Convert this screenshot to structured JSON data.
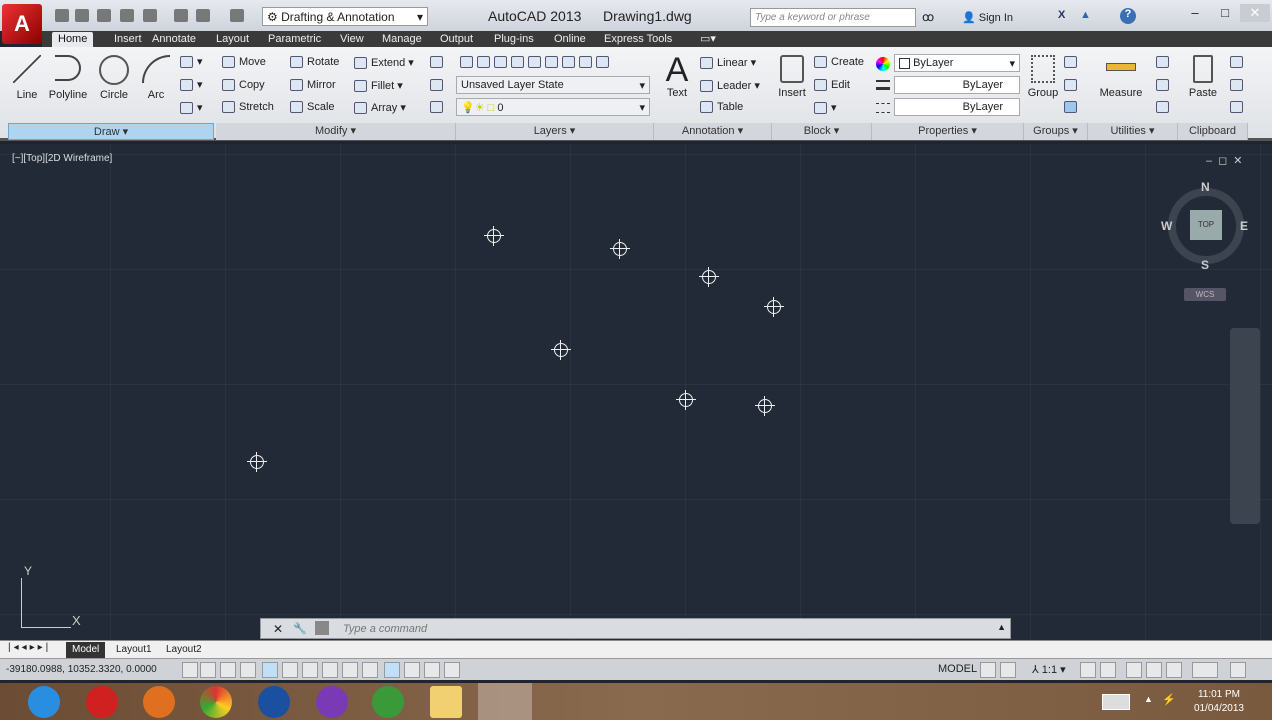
{
  "titlebar": {
    "app_title": "AutoCAD 2013",
    "file_title": "Drawing1.dwg",
    "workspace": "Drafting & Annotation",
    "search_placeholder": "Type a keyword or phrase",
    "sign_in": "Sign In",
    "logo": "A"
  },
  "tabs": [
    "Home",
    "Insert",
    "Annotate",
    "Layout",
    "Parametric",
    "View",
    "Manage",
    "Output",
    "Plug-ins",
    "Online",
    "Express Tools"
  ],
  "ribbon": {
    "draw": {
      "title": "Draw",
      "line": "Line",
      "polyline": "Polyline",
      "circle": "Circle",
      "arc": "Arc"
    },
    "modify": {
      "title": "Modify",
      "move": "Move",
      "rotate": "Rotate",
      "extend": "Extend",
      "copy": "Copy",
      "mirror": "Mirror",
      "fillet": "Fillet",
      "stretch": "Stretch",
      "scale": "Scale",
      "array": "Array"
    },
    "layers": {
      "title": "Layers",
      "layer_state": "Unsaved Layer State",
      "current_layer": "0"
    },
    "annotation": {
      "title": "Annotation",
      "text": "Text",
      "linear": "Linear",
      "leader": "Leader",
      "table": "Table"
    },
    "block": {
      "title": "Block",
      "insert": "Insert",
      "create": "Create",
      "edit": "Edit"
    },
    "properties": {
      "title": "Properties",
      "color": "ByLayer",
      "lineweight": "ByLayer",
      "linetype": "ByLayer"
    },
    "groups": {
      "title": "Groups",
      "group": "Group"
    },
    "utilities": {
      "title": "Utilities",
      "measure": "Measure"
    },
    "clipboard": {
      "title": "Clipboard",
      "paste": "Paste"
    }
  },
  "viewport": {
    "label": "[−][Top][2D Wireframe]",
    "compass": {
      "n": "N",
      "s": "S",
      "e": "E",
      "w": "W",
      "cube": "TOP"
    },
    "wcs": "WCS",
    "ucs_x": "X",
    "ucs_y": "Y"
  },
  "command": {
    "placeholder": "Type a command"
  },
  "layout_tabs": [
    "Model",
    "Layout1",
    "Layout2"
  ],
  "status": {
    "coords": "-39180.0988, 10352.3320, 0.0000",
    "model": "MODEL",
    "scale": "1:1"
  },
  "taskbar": {
    "time": "11:01 PM",
    "date": "01/04/2013"
  }
}
